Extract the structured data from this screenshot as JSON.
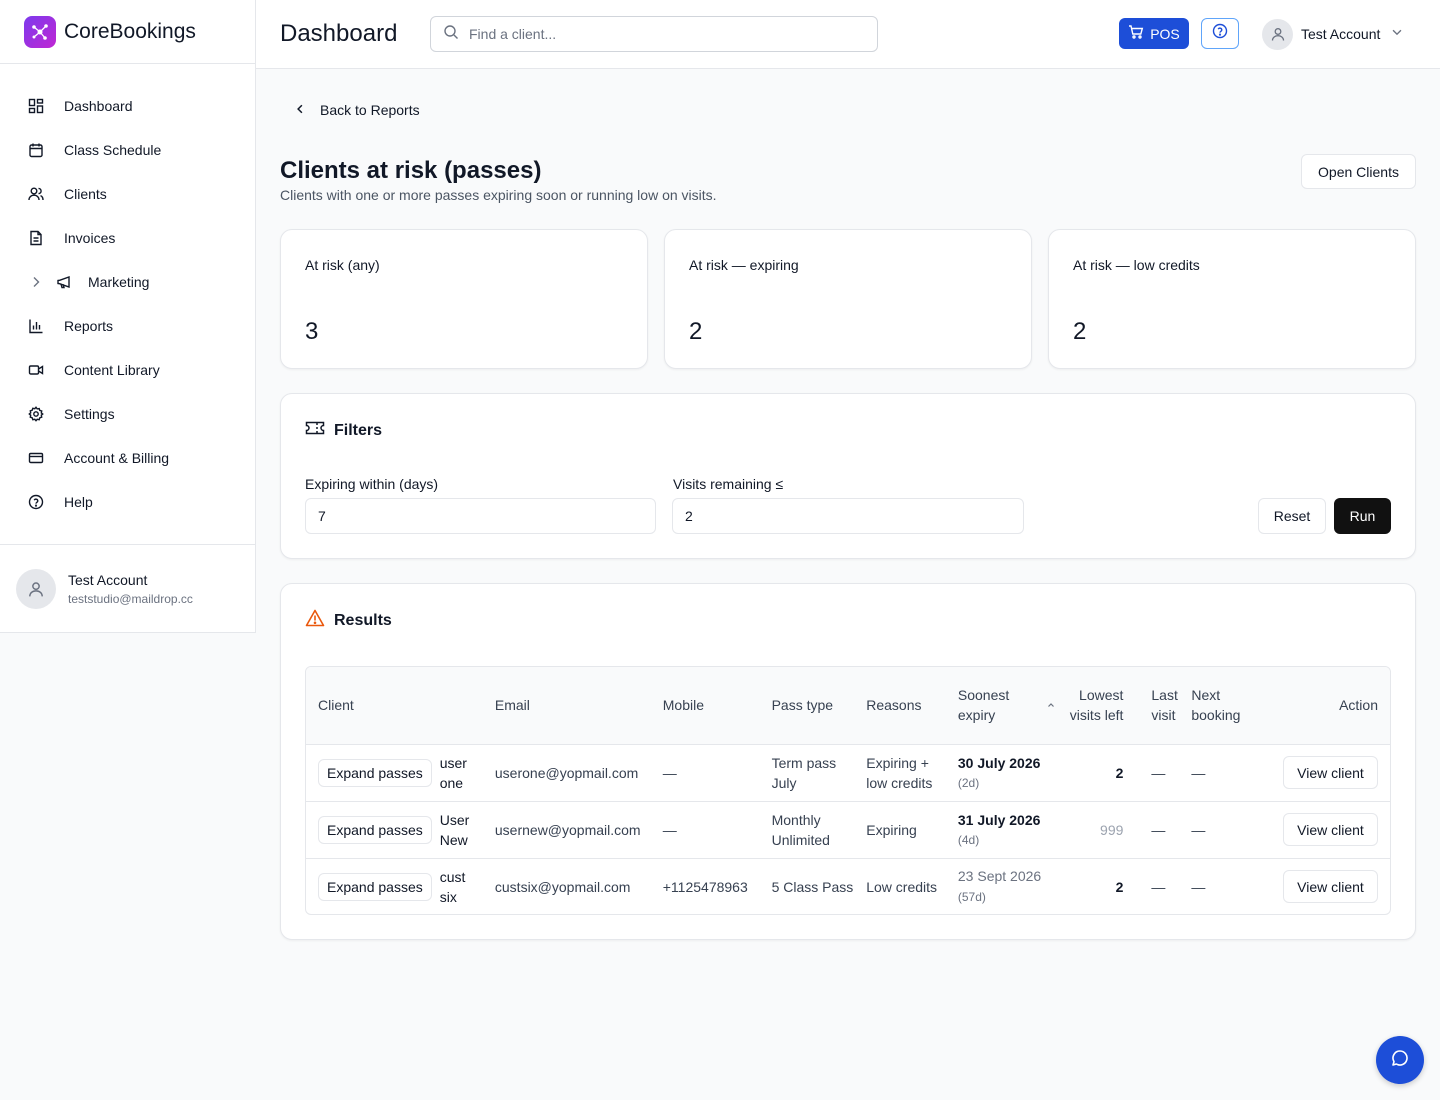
{
  "brand": {
    "name": "CoreBookings"
  },
  "sidebar": {
    "items": [
      {
        "label": "Dashboard",
        "icon": "grid-icon"
      },
      {
        "label": "Class Schedule",
        "icon": "calendar-icon"
      },
      {
        "label": "Clients",
        "icon": "users-icon"
      },
      {
        "label": "Invoices",
        "icon": "document-icon"
      },
      {
        "label": "Marketing",
        "icon": "megaphone-icon"
      },
      {
        "label": "Reports",
        "icon": "bar-chart-icon"
      },
      {
        "label": "Content Library",
        "icon": "video-icon"
      },
      {
        "label": "Settings",
        "icon": "gear-icon"
      },
      {
        "label": "Account & Billing",
        "icon": "credit-card-icon"
      },
      {
        "label": "Help",
        "icon": "help-circle-icon"
      }
    ],
    "user": {
      "name": "Test Account",
      "email": "teststudio@maildrop.cc"
    }
  },
  "header": {
    "title": "Dashboard",
    "search_placeholder": "Find a client...",
    "pos_label": "POS",
    "account_name": "Test Account"
  },
  "page": {
    "back_label": "Back to Reports",
    "title": "Clients at risk (passes)",
    "subtitle": "Clients with one or more passes expiring soon or running low on visits.",
    "open_clients_label": "Open Clients"
  },
  "stats": [
    {
      "label": "At risk (any)",
      "value": "3"
    },
    {
      "label": "At risk — expiring",
      "value": "2"
    },
    {
      "label": "At risk — low credits",
      "value": "2"
    }
  ],
  "filters": {
    "title": "Filters",
    "expiring_label": "Expiring within (days)",
    "expiring_value": "7",
    "visits_label": "Visits remaining ≤",
    "visits_value": "2",
    "reset_label": "Reset",
    "run_label": "Run"
  },
  "results": {
    "title": "Results",
    "columns": {
      "client": "Client",
      "email": "Email",
      "mobile": "Mobile",
      "pass_type": "Pass type",
      "reasons": "Reasons",
      "expiry": "Soonest expiry",
      "lowest": "Lowest visits left",
      "last_visit": "Last visit",
      "next_booking": "Next booking",
      "action": "Action"
    },
    "expand_label": "Expand passes",
    "view_label": "View client",
    "rows": [
      {
        "client": "user one",
        "email": "userone@yopmail.com",
        "mobile": "—",
        "pass_type": "Term pass July",
        "reasons": "Expiring + low credits",
        "expiry": "30 July 2026",
        "expiry_rel": "(2d)",
        "lowest": "2",
        "last_visit": "—",
        "next_booking": "—"
      },
      {
        "client": "User New",
        "email": "usernew@yopmail.com",
        "mobile": "—",
        "pass_type": "Monthly Unlimited",
        "reasons": "Expiring",
        "expiry": "31 July 2026",
        "expiry_rel": "(4d)",
        "lowest": "999",
        "last_visit": "—",
        "next_booking": "—"
      },
      {
        "client": "cust six",
        "email": "custsix@yopmail.com",
        "mobile": "+1125478963",
        "pass_type": "5 Class Pass",
        "reasons": "Low credits",
        "expiry": "23 Sept 2026",
        "expiry_rel": "(57d)",
        "lowest": "2",
        "last_visit": "—",
        "next_booking": "—"
      }
    ]
  },
  "colors": {
    "accent": "#1d4ed8",
    "brand_gradient_start": "#7c3aed",
    "brand_gradient_end": "#c026d3",
    "warning": "#ea580c"
  }
}
